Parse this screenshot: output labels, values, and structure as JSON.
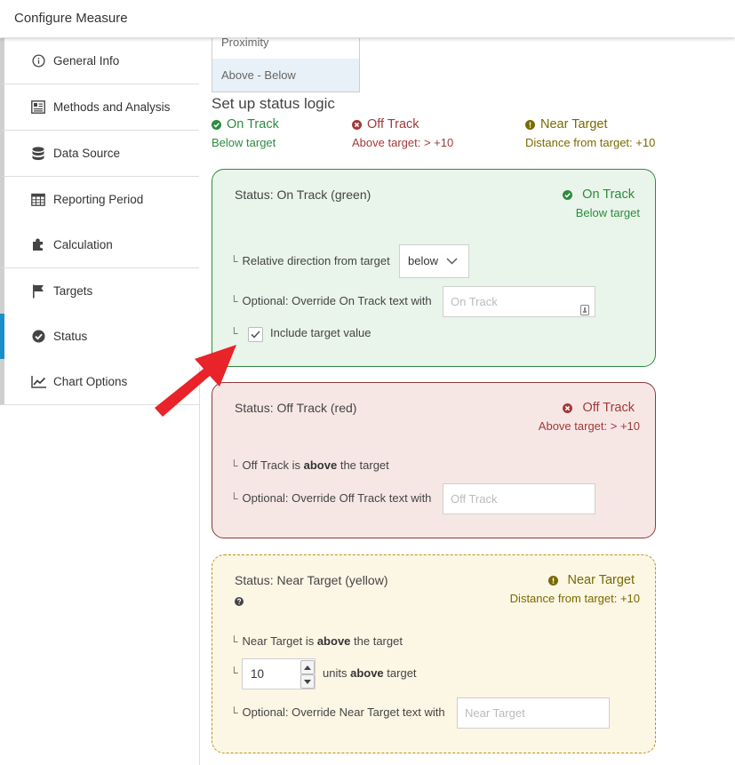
{
  "header": {
    "title": "Configure Measure"
  },
  "sidebar": {
    "items": [
      {
        "label": "General Info",
        "icon": "info-icon"
      },
      {
        "label": "Methods and Analysis",
        "icon": "document-icon"
      },
      {
        "label": "Data Source",
        "icon": "database-icon"
      },
      {
        "label": "Reporting Period",
        "icon": "calendar-icon"
      },
      {
        "label": "Calculation",
        "icon": "puzzle-icon"
      },
      {
        "label": "Targets",
        "icon": "flag-icon"
      },
      {
        "label": "Status",
        "icon": "check-circle-icon",
        "active": true
      },
      {
        "label": "Chart Options",
        "icon": "line-chart-icon"
      }
    ]
  },
  "method_dropdown": {
    "options": [
      "Proximity",
      "Above - Below"
    ],
    "selected": "Above - Below"
  },
  "status_logic": {
    "heading": "Set up status logic",
    "summary": {
      "on_track": {
        "label": "On Track",
        "sub": "Below target"
      },
      "off_track": {
        "label": "Off Track",
        "sub": "Above target: > +10"
      },
      "near_target": {
        "label": "Near Target",
        "sub": "Distance from target: +10"
      }
    }
  },
  "cards": {
    "on_track": {
      "title": "Status: On Track (green)",
      "badge": "On Track",
      "badge_sub": "Below target",
      "direction_label": "Relative direction from target",
      "direction_value": "below",
      "override_label": "Optional: Override On Track text with",
      "override_placeholder": "On Track",
      "include_label": "Include target value",
      "include_checked": true
    },
    "off_track": {
      "title": "Status: Off Track (red)",
      "badge": "Off Track",
      "badge_sub": "Above target: > +10",
      "rule_prefix": "Off Track is",
      "rule_bold": "above",
      "rule_suffix": "the target",
      "override_label": "Optional: Override Off Track text with",
      "override_placeholder": "Off Track"
    },
    "near_target": {
      "title": "Status: Near Target (yellow)",
      "badge": "Near Target",
      "badge_sub": "Distance from target: +10",
      "rule_prefix": "Near Target is",
      "rule_bold": "above",
      "rule_suffix": "the target",
      "units_value": "10",
      "units_prefix": "units",
      "units_bold": "above",
      "units_suffix": "target",
      "override_label": "Optional: Override Near Target text with",
      "override_placeholder": "Near Target"
    }
  },
  "colors": {
    "green": "#2e8b3f",
    "red": "#a23a3a",
    "olive": "#7a6a00",
    "active": "#1a8fc9",
    "arrow": "#e8232a"
  }
}
